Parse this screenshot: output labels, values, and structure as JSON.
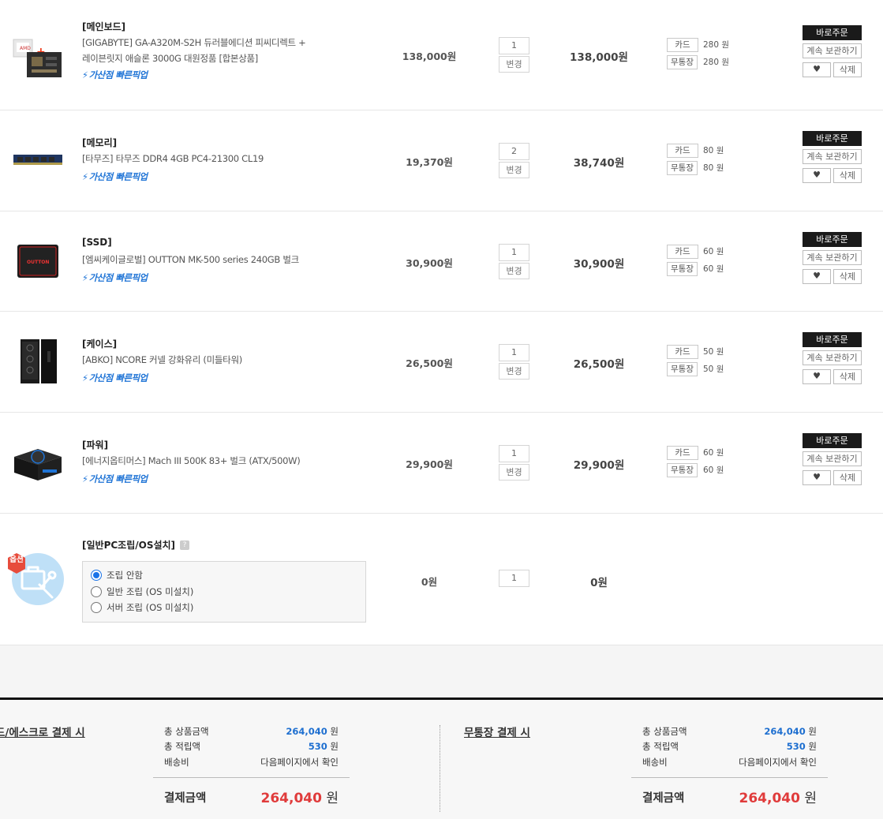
{
  "items": [
    {
      "category": "[메인보드]",
      "name_lines": [
        "[GIGABYTE] GA-A320M-S2H 듀러블에디션 피씨디렉트 +",
        "레이븐릿지 애슬론 3000G 대원정품 [합본상품]"
      ],
      "pickup": "가산점 빠른픽업",
      "unit_price": "138,000원",
      "qty": "1",
      "change_label": "변경",
      "total": "138,000원",
      "card_label": "카드",
      "card_points": "280 원",
      "bank_label": "무통장",
      "bank_points": "280 원",
      "buy_label": "바로주문",
      "keep_label": "계속 보관하기",
      "delete_label": "삭제",
      "icon": "cpu-mainboard-bundle-image"
    },
    {
      "category": "[메모리]",
      "name_lines": [
        "[타무즈] 타무즈 DDR4 4GB PC4-21300 CL19"
      ],
      "pickup": "가산점 빠른픽업",
      "unit_price": "19,370원",
      "qty": "2",
      "change_label": "변경",
      "total": "38,740원",
      "card_label": "카드",
      "card_points": "80 원",
      "bank_label": "무통장",
      "bank_points": "80 원",
      "buy_label": "바로주문",
      "keep_label": "계속 보관하기",
      "delete_label": "삭제",
      "icon": "ram-stick-image"
    },
    {
      "category": "[SSD]",
      "name_lines": [
        "[엠씨케이글로벌] OUTTON MK-500 series 240GB 벌크"
      ],
      "pickup": "가산점 빠른픽업",
      "unit_price": "30,900원",
      "qty": "1",
      "change_label": "변경",
      "total": "30,900원",
      "card_label": "카드",
      "card_points": "60 원",
      "bank_label": "무통장",
      "bank_points": "60 원",
      "buy_label": "바로주문",
      "keep_label": "계속 보관하기",
      "delete_label": "삭제",
      "icon": "ssd-image"
    },
    {
      "category": "[케이스]",
      "name_lines": [
        "[ABKO] NCORE 커넬 강화유리 (미들타워)"
      ],
      "pickup": "가산점 빠른픽업",
      "unit_price": "26,500원",
      "qty": "1",
      "change_label": "변경",
      "total": "26,500원",
      "card_label": "카드",
      "card_points": "50 원",
      "bank_label": "무통장",
      "bank_points": "50 원",
      "buy_label": "바로주문",
      "keep_label": "계속 보관하기",
      "delete_label": "삭제",
      "icon": "pc-case-image"
    },
    {
      "category": "[파워]",
      "name_lines": [
        "[에너지옵티머스] Mach III 500K 83+ 벌크 (ATX/500W)"
      ],
      "pickup": "가산점 빠른픽업",
      "unit_price": "29,900원",
      "qty": "1",
      "change_label": "변경",
      "total": "29,900원",
      "card_label": "카드",
      "card_points": "60 원",
      "bank_label": "무통장",
      "bank_points": "60 원",
      "buy_label": "바로주문",
      "keep_label": "계속 보관하기",
      "delete_label": "삭제",
      "icon": "power-supply-image"
    }
  ],
  "option": {
    "badge": "옵션",
    "category": "[일반PC조립/OS설치]",
    "help": "?",
    "choices": [
      "조립 안함",
      "일반 조립 (OS 미설치)",
      "서버 조립 (OS 미설치)"
    ],
    "selected_index": 0,
    "unit_price": "0원",
    "qty": "1",
    "total": "0원"
  },
  "summary": {
    "left": {
      "title": "드/에스크로 결제 시",
      "product_total_label": "총 상품금액",
      "product_total_value": "264,040",
      "product_total_unit": " 원",
      "points_label": "총 적립액",
      "points_value": "530",
      "points_unit": " 원",
      "shipping_label": "배송비",
      "shipping_value": "다음페이지에서 확인",
      "pay_label": "결제금액",
      "pay_value": "264,040",
      "pay_unit": " 원"
    },
    "right": {
      "title": "무통장 결제 시",
      "product_total_label": "총 상품금액",
      "product_total_value": "264,040",
      "product_total_unit": " 원",
      "points_label": "총 적립액",
      "points_value": "530",
      "points_unit": " 원",
      "shipping_label": "배송비",
      "shipping_value": "다음페이지에서 확인",
      "pay_label": "결제금액",
      "pay_value": "264,040",
      "pay_unit": " 원"
    }
  },
  "colors": {
    "accent_blue": "#1e6fd0",
    "pay_red": "#e03b3b",
    "dark_button": "#1a1a1a",
    "option_badge": "#e74c3c"
  }
}
